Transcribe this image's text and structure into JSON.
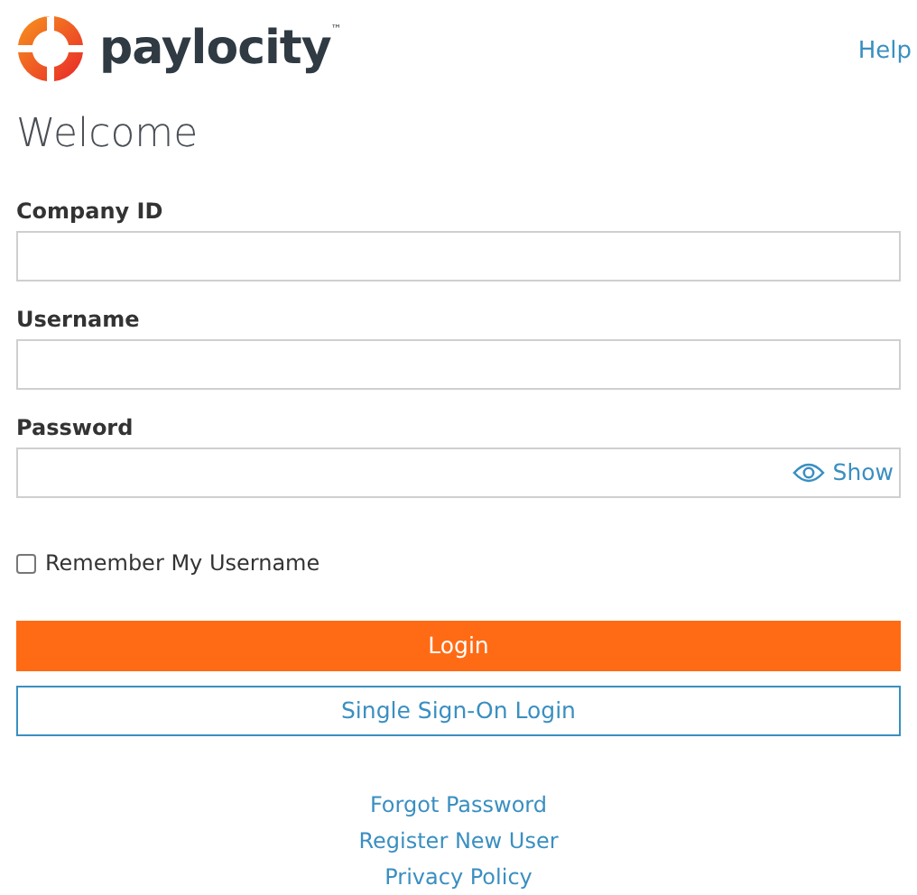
{
  "header": {
    "brand": "paylocity",
    "trademark": "™",
    "help_link": "Help"
  },
  "title": "Welcome",
  "fields": [
    {
      "label": "Company ID",
      "kind": "text"
    },
    {
      "label": "Username",
      "kind": "text"
    },
    {
      "label": "Password",
      "kind": "password",
      "toggle": "Show"
    }
  ],
  "remember": {
    "label": "Remember My Username",
    "checked": false
  },
  "buttons": [
    {
      "label": "Login",
      "kind": "primary"
    },
    {
      "label": "Single Sign-On Login",
      "kind": "outline"
    }
  ],
  "links": [
    "Forgot Password",
    "Register New User",
    "Privacy Policy"
  ]
}
